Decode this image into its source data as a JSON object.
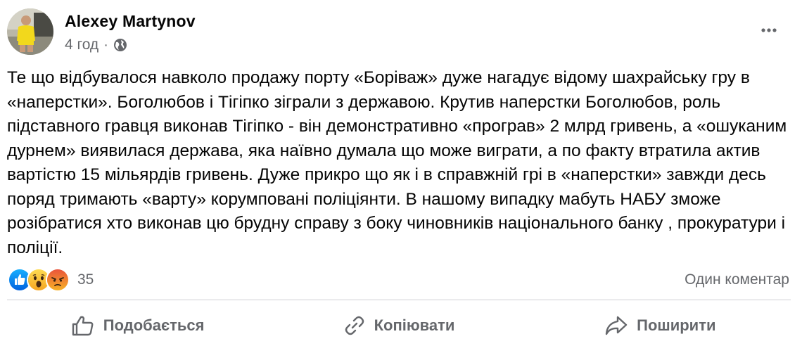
{
  "post": {
    "author": "Alexey Martynov",
    "time": "4 год",
    "separator": "·",
    "privacy_icon": "globe-icon",
    "more_icon": "more-icon",
    "text": "Те що відбувалося навколо продажу порту «Боріваж» дуже нагадує відому шахрайську гру в «наперстки». Боголюбов і Тігіпко зіграли з державою. Крутив наперстки Боголюбов, роль підставного гравця виконав Тігіпко - він демонстративно «програв» 2 млрд гривень, а «ошуканим дурнем» виявилася держава, яка наївно думала що може виграти, а по факту втратила актив вартістю 15 мільярдів гривень. Дуже прикро що як і в справжній грі в «наперстки» завжди десь поряд тримають «варту» корумповані поліціянти. В нашому випадку мабуть НАБУ зможе розібратися хто виконав цю брудну справу з боку чиновників національного банку , прокуратури і поліції."
  },
  "reactions": {
    "icons": [
      "like-icon",
      "wow-icon",
      "angry-icon"
    ],
    "count": "35",
    "comments": "Один коментар"
  },
  "actions": {
    "like": "Подобається",
    "copy": "Копіювати",
    "share": "Поширити"
  },
  "colors": {
    "like_blue": "#1877f2",
    "reaction_yellow": "#f7b125",
    "angry_orange": "#e9710f",
    "secondary_text": "#65676b"
  }
}
